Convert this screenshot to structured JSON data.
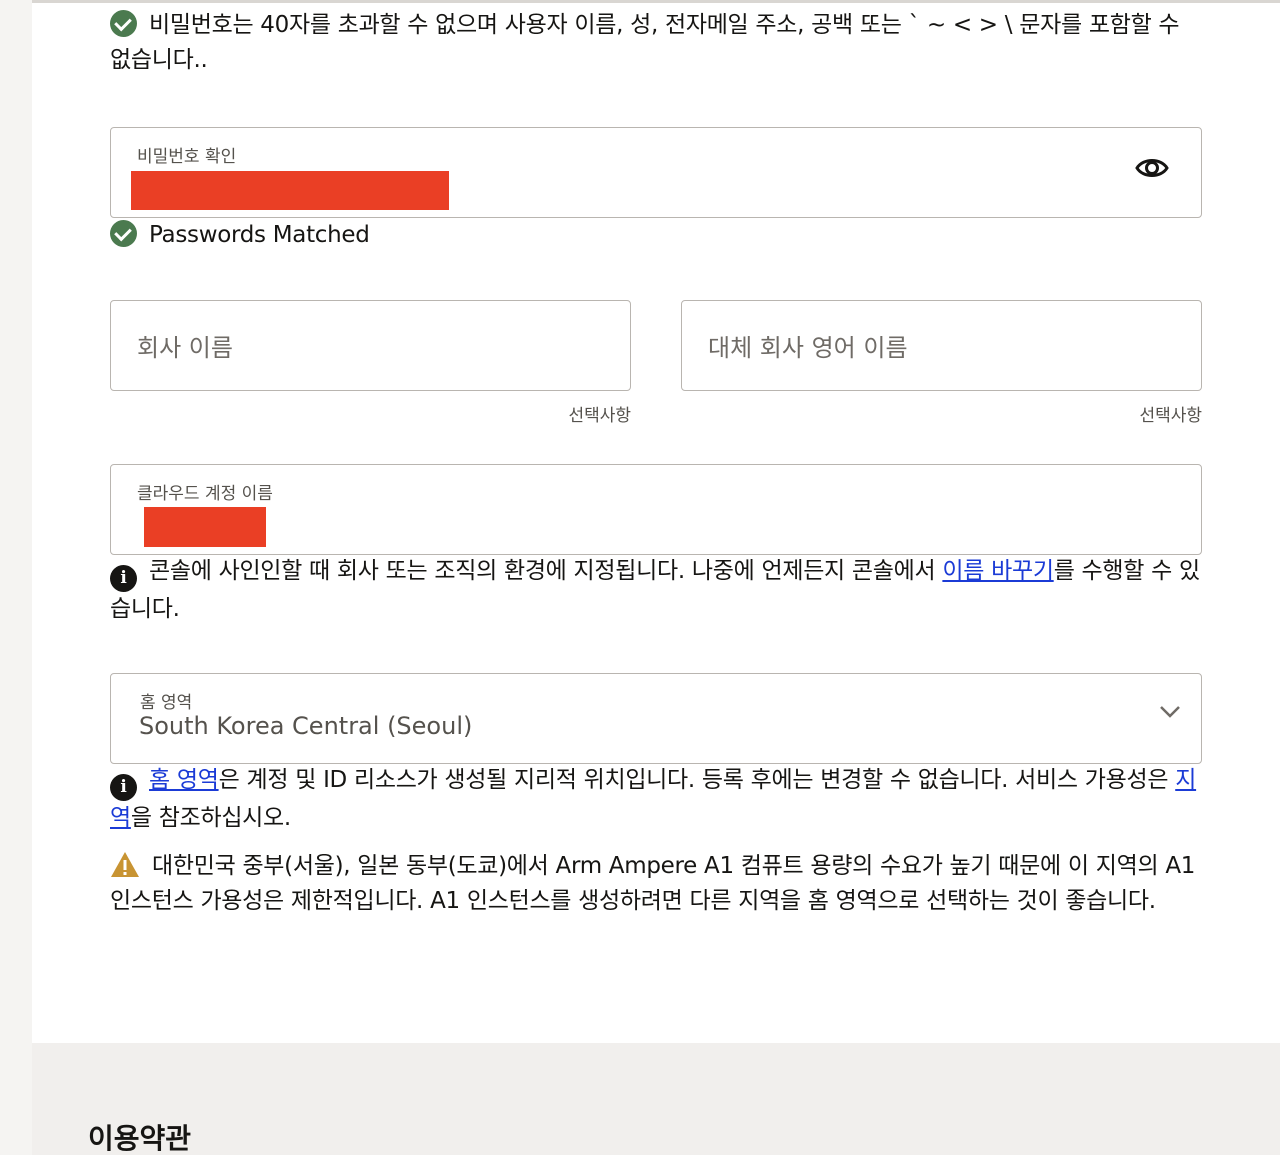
{
  "password_rule": {
    "text": "비밀번호는 40자를 초과할 수 없으며 사용자 이름, 성, 전자메일 주소, 공백 또는 ` ~ < > \\ 문자를 포함할 수 없습니다.."
  },
  "confirm_password": {
    "label": "비밀번호 확인",
    "status_text": "Passwords Matched"
  },
  "company_name": {
    "placeholder": "회사 이름",
    "hint": "선택사항"
  },
  "alt_company_name": {
    "placeholder": "대체 회사 영어 이름",
    "hint": "선택사항"
  },
  "cloud_account": {
    "label": "클라우드 계정 이름",
    "info_before": "콘솔에 사인인할 때 회사 또는 조직의 환경에 지정됩니다. 나중에 언제든지 콘솔에서 ",
    "info_link": "이름 바꾸기",
    "info_after": "를 수행할 수 있습니다."
  },
  "home_region": {
    "label": "홈 영역",
    "value": "South Korea Central (Seoul)",
    "info_link1": "홈 영역",
    "info_mid": "은 계정 및 ID 리소스가 생성될 지리적 위치입니다. 등록 후에는 변경할 수 없습니다. 서비스 가용성은 ",
    "info_link2": "지역",
    "info_after": "을 참조하십시오.",
    "warning": "대한민국 중부(서울), 일본 동부(도쿄)에서 Arm Ampere A1 컴퓨트 용량의 수요가 높기 때문에 이 지역의 A1 인스턴스 가용성은 제한적입니다. A1 인스턴스를 생성하려면 다른 지역을 홈 영역으로 선택하는 것이 좋습니다."
  },
  "terms": {
    "heading": "이용약관"
  },
  "colors": {
    "success": "#4b7a4f",
    "link": "#1b3bd6",
    "redaction": "#ea3f25",
    "warning": "#c89433"
  }
}
